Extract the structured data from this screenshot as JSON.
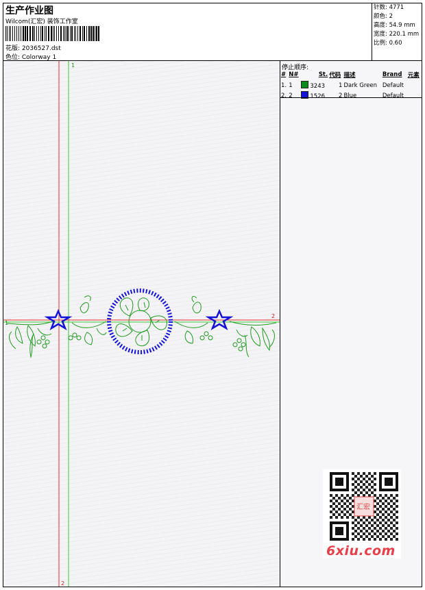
{
  "header": {
    "title": "生产作业图",
    "company": "Wilcom(汇宏) 装饰工作室",
    "design_line": "花版: 2036527.dst",
    "colorway_line": "色位: Colorway 1"
  },
  "specs": {
    "stitches": "针数: 4771",
    "colors": "颜色: 2",
    "height": "高度: 54.9 mm",
    "width": "宽度: 220.1 mm",
    "ratio": "比例: 0.60"
  },
  "stop_sequence": {
    "title": "停止顺序:",
    "columns": [
      "#",
      "N#",
      "St.",
      "代码",
      "描述",
      "Brand",
      "元素"
    ],
    "rows": [
      {
        "idx": "1.",
        "n": "1",
        "color": "#0a8a1a",
        "st": "3243",
        "code": "1",
        "desc": "Dark Green",
        "brand": "Default"
      },
      {
        "idx": "2.",
        "n": "2",
        "color": "#1414d6",
        "st": "1526",
        "code": "2",
        "desc": "Blue",
        "brand": "Default"
      }
    ]
  },
  "guides": {
    "vertical_top_label": "1",
    "vertical_bottom_label": "2",
    "horizontal_right_label": "2",
    "horizontal_left_label": "1"
  },
  "colors": {
    "green_thread": "#1f9a1f",
    "blue_thread": "#1414d6",
    "red_guide": "#e03030",
    "green_guide": "#33cc33",
    "brand_red": "#e8404a"
  },
  "watermark": {
    "brand": "6xiu.com",
    "stamp": "汇宏"
  }
}
